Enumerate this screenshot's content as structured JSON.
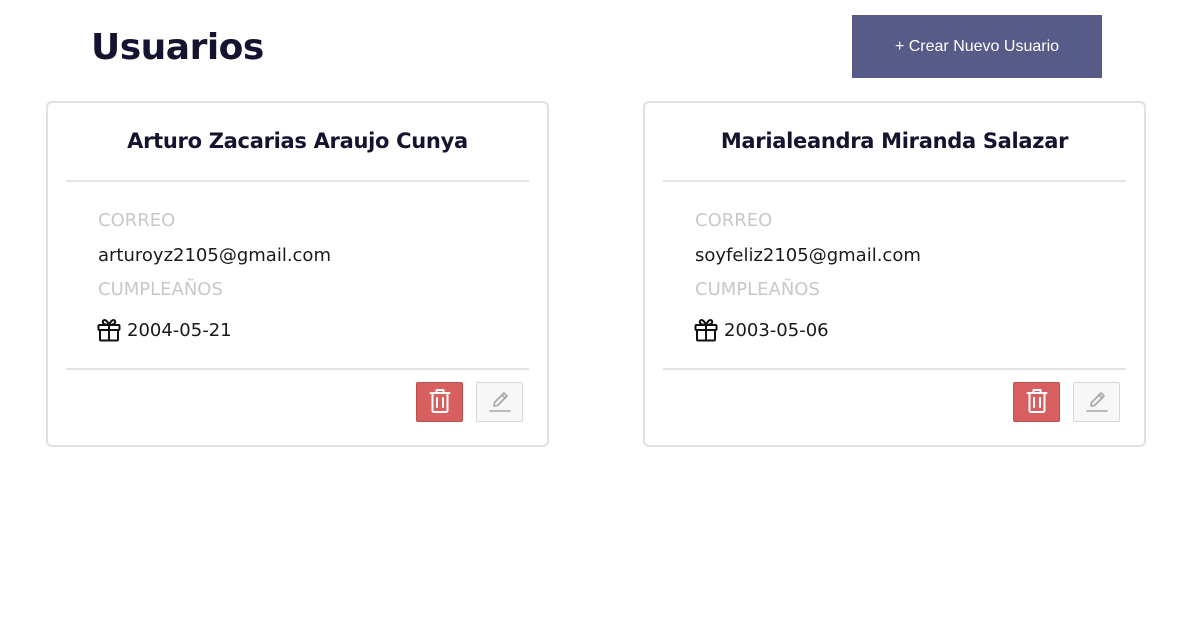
{
  "header": {
    "title": "Usuarios",
    "create_button_label": "+ Crear Nuevo Usuario"
  },
  "users": [
    {
      "name": "Arturo Zacarias Araujo Cunya",
      "email_label": "CORREO",
      "email": "arturoyz2105@gmail.com",
      "birthday_label": "CUMPLEAÑOS",
      "birthday": "2004-05-21"
    },
    {
      "name": "Marialeandra Miranda Salazar",
      "email_label": "CORREO",
      "email": "soyfeliz2105@gmail.com",
      "birthday_label": "CUMPLEAÑOS",
      "birthday": "2003-05-06"
    }
  ],
  "icons": {
    "birthday": "gift-icon",
    "delete": "trash-icon",
    "edit": "pencil-icon"
  },
  "colors": {
    "primary_button": "#585b87",
    "delete_button": "#d75f60",
    "title": "#141330",
    "label": "#c8c8c8"
  }
}
